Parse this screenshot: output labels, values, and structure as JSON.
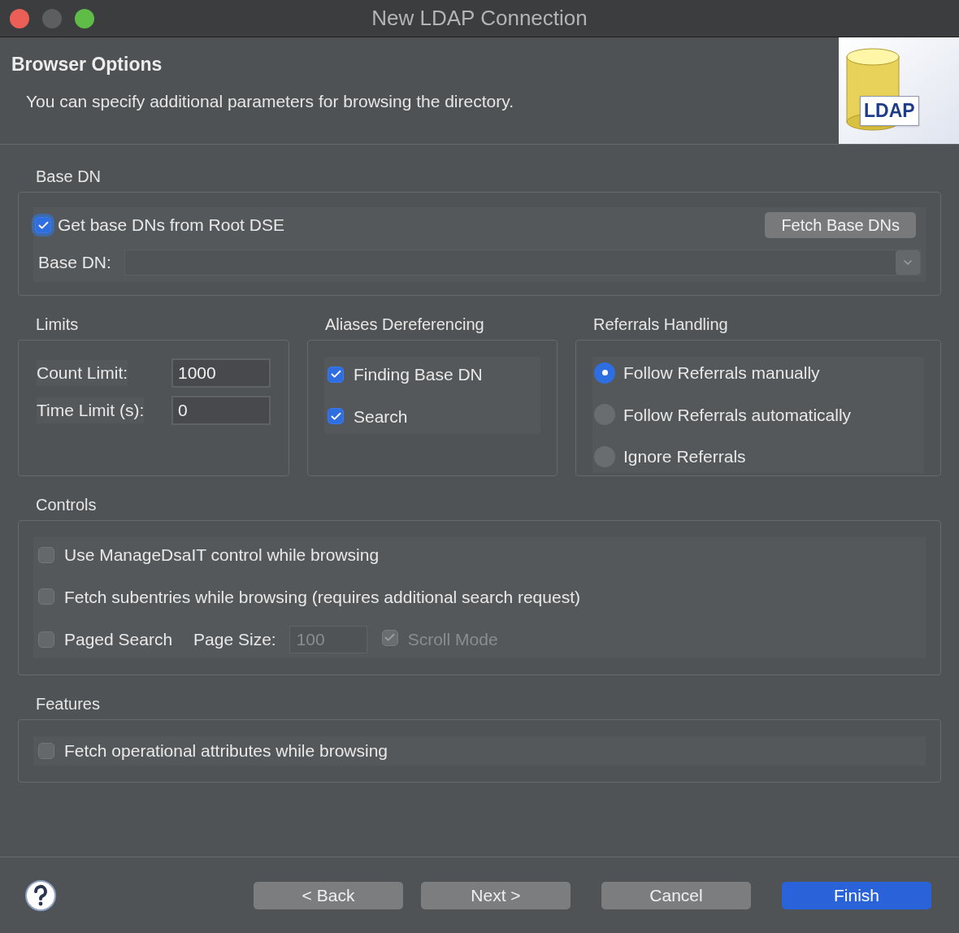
{
  "window": {
    "title": "New LDAP Connection"
  },
  "header": {
    "title": "Browser Options",
    "description": "You can specify additional parameters for browsing the directory.",
    "logo_text": "LDAP"
  },
  "base_dn": {
    "title": "Base DN",
    "checkbox": {
      "label": "Get base DNs from Root DSE",
      "checked": true
    },
    "fetch_button": "Fetch Base DNs",
    "field_label": "Base DN:"
  },
  "limits": {
    "title": "Limits",
    "fields": [
      {
        "label": "Count Limit:",
        "value": "1000"
      },
      {
        "label": "Time Limit (s):",
        "value": "0"
      }
    ]
  },
  "aliases": {
    "title": "Aliases Dereferencing",
    "options": [
      {
        "label": "Finding Base DN",
        "checked": true
      },
      {
        "label": "Search",
        "checked": true
      }
    ]
  },
  "referrals": {
    "title": "Referrals Handling",
    "options": [
      {
        "label": "Follow Referrals manually",
        "selected": true
      },
      {
        "label": "Follow Referrals automatically",
        "selected": false
      },
      {
        "label": "Ignore Referrals",
        "selected": false
      }
    ]
  },
  "controls": {
    "title": "Controls",
    "options": [
      {
        "label": "Use ManageDsaIT control while browsing",
        "checked": false
      },
      {
        "label": "Fetch subentries while browsing (requires additional search request)",
        "checked": false
      }
    ],
    "paged": {
      "label": "Paged Search",
      "checked": false,
      "page_size_label": "Page Size:",
      "page_size": "100",
      "page_size_disabled": true,
      "scroll_mode": {
        "label": "Scroll Mode",
        "checked": true,
        "disabled": true
      }
    }
  },
  "features": {
    "title": "Features",
    "options": [
      {
        "label": "Fetch operational attributes while browsing",
        "checked": false
      }
    ]
  },
  "buttons": [
    {
      "label": "< Back",
      "kind": "normal"
    },
    {
      "label": "Next >",
      "kind": "normal"
    },
    {
      "label": "Cancel",
      "kind": "normal"
    },
    {
      "label": "Finish",
      "kind": "primary"
    }
  ]
}
